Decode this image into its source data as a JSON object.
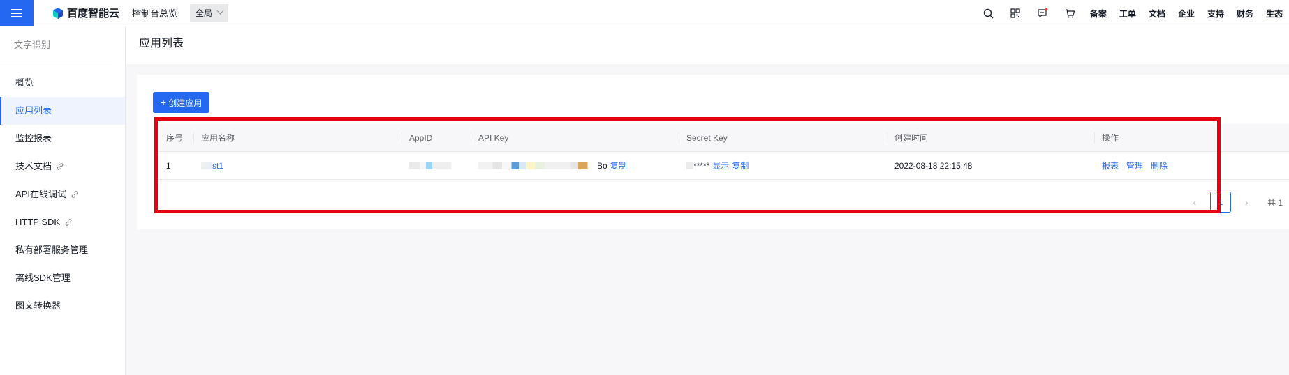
{
  "topbar": {
    "logo_text": "百度智能云",
    "console_link": "控制台总览",
    "region": "全局",
    "icons": [
      "search-icon",
      "qrcode-icon",
      "message-icon",
      "cart-icon"
    ],
    "nav": [
      "备案",
      "工单",
      "文档",
      "企业",
      "支持",
      "财务",
      "生态"
    ],
    "colors": {
      "accent": "#2468f2",
      "notice_dot": "#f33e3e"
    }
  },
  "sidebar": {
    "title": "文字识别",
    "items": [
      {
        "label": "概览",
        "active": false,
        "link": false
      },
      {
        "label": "应用列表",
        "active": true,
        "link": false
      },
      {
        "label": "监控报表",
        "active": false,
        "link": false
      },
      {
        "label": "技术文档",
        "active": false,
        "link": true
      },
      {
        "label": "API在线调试",
        "active": false,
        "link": true
      },
      {
        "label": "HTTP SDK",
        "active": false,
        "link": true
      },
      {
        "label": "私有部署服务管理",
        "active": false,
        "link": false
      },
      {
        "label": "离线SDK管理",
        "active": false,
        "link": false
      },
      {
        "label": "图文转换器",
        "active": false,
        "link": false
      }
    ]
  },
  "page": {
    "title": "应用列表",
    "create_button": "创建应用"
  },
  "table": {
    "columns": [
      "序号",
      "应用名称",
      "AppID",
      "API Key",
      "Secret Key",
      "创建时间",
      "操作"
    ],
    "rows": [
      {
        "index": "1",
        "name_visible": "st1",
        "api_key_suffix": "Bo",
        "api_key_copy": "复制",
        "secret_masked": "*****",
        "secret_show": "显示",
        "secret_copy": "复制",
        "created": "2022-08-18 22:15:48",
        "ops": [
          "报表",
          "管理",
          "删除"
        ]
      }
    ]
  },
  "pager": {
    "current": "1",
    "total": "共 1"
  },
  "highlight_color": "#e60012"
}
